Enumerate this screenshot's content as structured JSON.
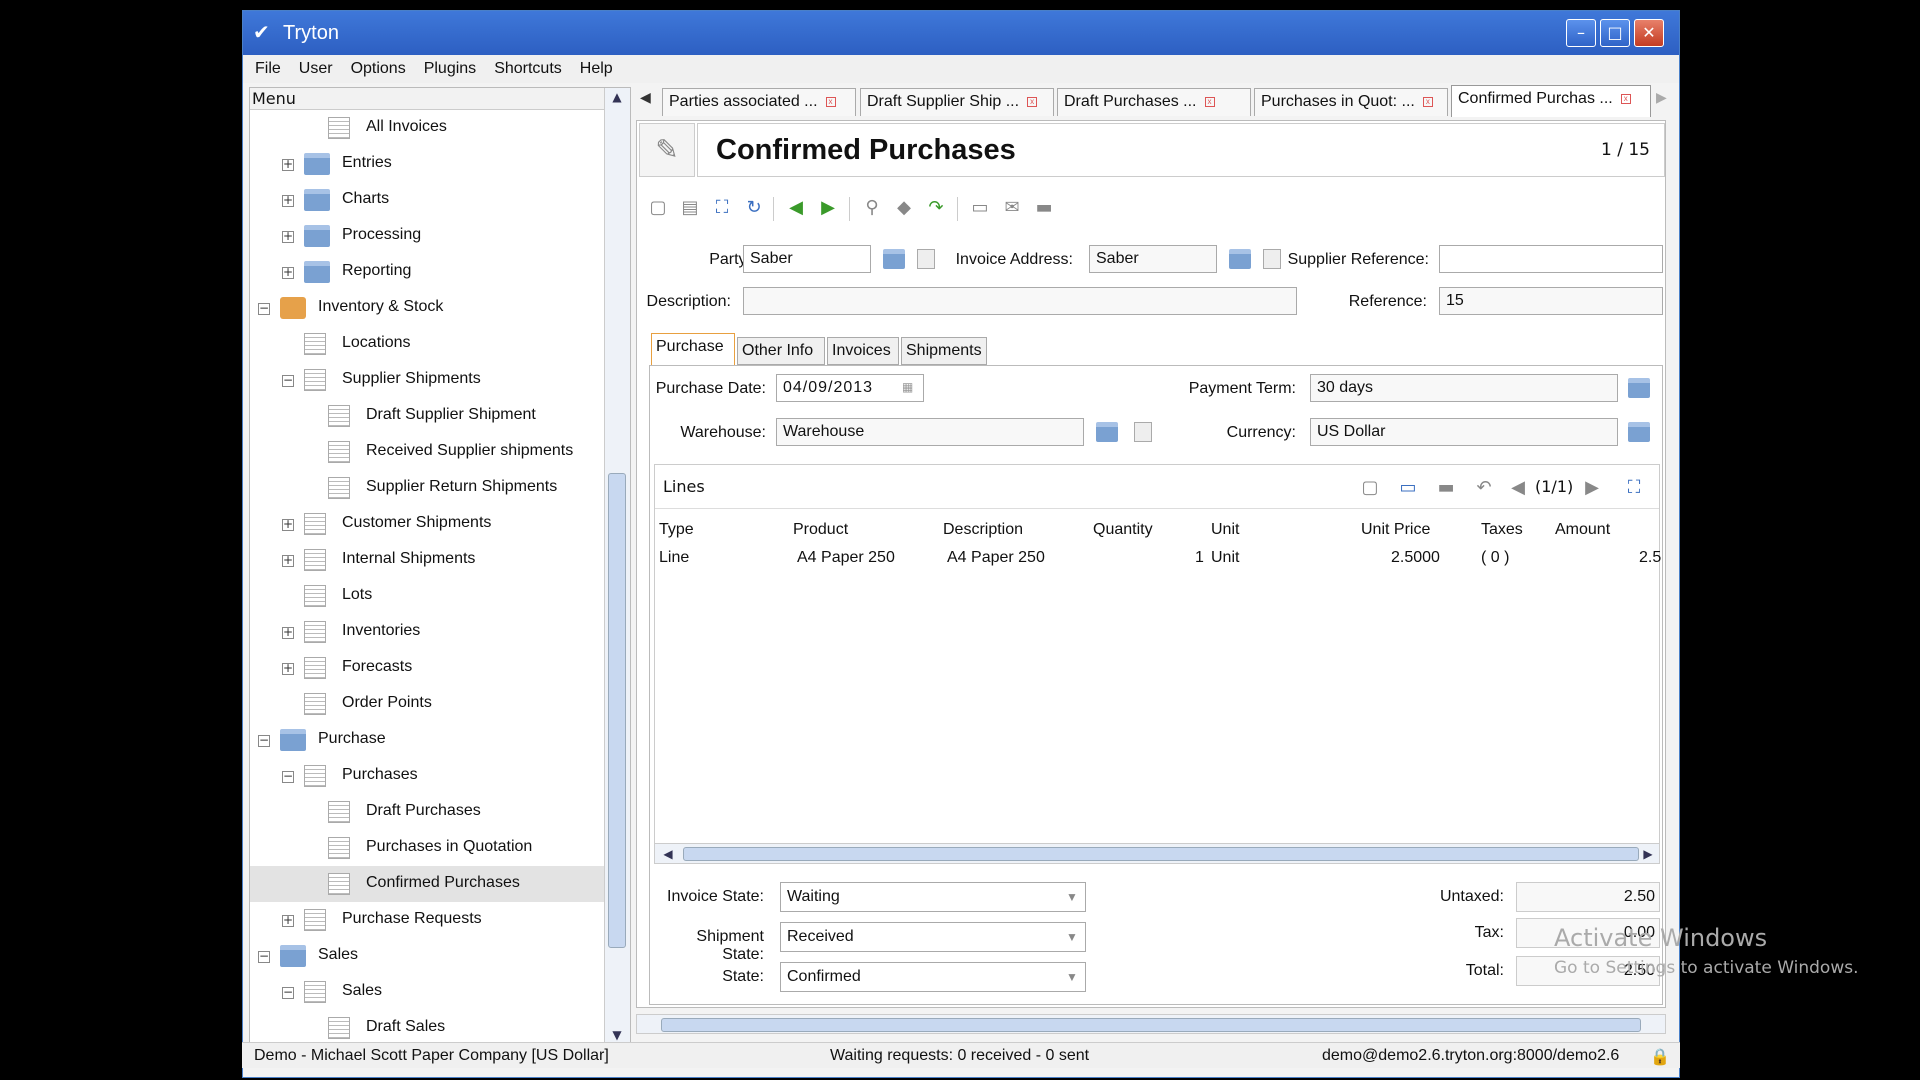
{
  "window": {
    "title": "Tryton"
  },
  "menubar": [
    "File",
    "User",
    "Options",
    "Plugins",
    "Shortcuts",
    "Help"
  ],
  "sidebar": {
    "header": "Menu",
    "items": [
      {
        "label": "All Invoices",
        "level": 2,
        "icon": "doc",
        "toggle": ""
      },
      {
        "label": "Entries",
        "level": 1,
        "icon": "folder",
        "toggle": "+"
      },
      {
        "label": "Charts",
        "level": 1,
        "icon": "folder",
        "toggle": "+"
      },
      {
        "label": "Processing",
        "level": 1,
        "icon": "folder",
        "toggle": "+"
      },
      {
        "label": "Reporting",
        "level": 1,
        "icon": "folder",
        "toggle": "+"
      },
      {
        "label": "Inventory & Stock",
        "level": 0,
        "icon": "inv",
        "toggle": "−"
      },
      {
        "label": "Locations",
        "level": 1,
        "icon": "doc",
        "toggle": ""
      },
      {
        "label": "Supplier Shipments",
        "level": 1,
        "icon": "doc",
        "toggle": "−"
      },
      {
        "label": "Draft Supplier Shipment",
        "level": 2,
        "icon": "doc",
        "toggle": ""
      },
      {
        "label": "Received Supplier shipments",
        "level": 2,
        "icon": "doc",
        "toggle": ""
      },
      {
        "label": "Supplier Return Shipments",
        "level": 2,
        "icon": "doc",
        "toggle": ""
      },
      {
        "label": "Customer Shipments",
        "level": 1,
        "icon": "doc",
        "toggle": "+"
      },
      {
        "label": "Internal Shipments",
        "level": 1,
        "icon": "doc",
        "toggle": "+"
      },
      {
        "label": "Lots",
        "level": 1,
        "icon": "doc",
        "toggle": ""
      },
      {
        "label": "Inventories",
        "level": 1,
        "icon": "doc",
        "toggle": "+"
      },
      {
        "label": "Forecasts",
        "level": 1,
        "icon": "doc",
        "toggle": "+"
      },
      {
        "label": "Order Points",
        "level": 1,
        "icon": "doc",
        "toggle": ""
      },
      {
        "label": "Purchase",
        "level": 0,
        "icon": "folder",
        "toggle": "−"
      },
      {
        "label": "Purchases",
        "level": 1,
        "icon": "doc",
        "toggle": "−"
      },
      {
        "label": "Draft Purchases",
        "level": 2,
        "icon": "doc",
        "toggle": ""
      },
      {
        "label": "Purchases in Quotation",
        "level": 2,
        "icon": "doc",
        "toggle": ""
      },
      {
        "label": "Confirmed Purchases",
        "level": 2,
        "icon": "doc",
        "toggle": "",
        "selected": true
      },
      {
        "label": "Purchase Requests",
        "level": 1,
        "icon": "doc",
        "toggle": "+"
      },
      {
        "label": "Sales",
        "level": 0,
        "icon": "folder",
        "toggle": "−"
      },
      {
        "label": "Sales",
        "level": 1,
        "icon": "doc",
        "toggle": "−"
      },
      {
        "label": "Draft Sales",
        "level": 2,
        "icon": "doc",
        "toggle": ""
      }
    ]
  },
  "tabs": [
    {
      "label": "Parties associated ..."
    },
    {
      "label": "Draft Supplier Ship ..."
    },
    {
      "label": "Draft Purchases     ..."
    },
    {
      "label": "Purchases in Quot: ..."
    },
    {
      "label": "Confirmed Purchas ...",
      "active": true
    }
  ],
  "form": {
    "title": "Confirmed Purchases",
    "counter": "1 / 15",
    "party_label": "Party:",
    "party_value": "Saber",
    "invoice_address_label": "Invoice Address:",
    "invoice_address_value": "Saber",
    "supplier_reference_label": "Supplier Reference:",
    "supplier_reference_value": "",
    "description_label": "Description:",
    "description_value": "",
    "reference_label": "Reference:",
    "reference_value": "15",
    "subtabs": [
      "Purchase",
      "Other Info",
      "Invoices",
      "Shipments"
    ],
    "purchase_date_label": "Purchase Date:",
    "purchase_date_value": "04/09/2013",
    "payment_term_label": "Payment Term:",
    "payment_term_value": "30 days",
    "warehouse_label": "Warehouse:",
    "warehouse_value": "Warehouse",
    "currency_label": "Currency:",
    "currency_value": "US Dollar",
    "lines_label": "Lines",
    "lines_counter": "(1/1)",
    "columns": [
      "Type",
      "Product",
      "Description",
      "Quantity",
      "Unit",
      "Unit Price",
      "Taxes",
      "Amount"
    ],
    "rows": [
      {
        "type": "Line",
        "product": "A4 Paper 250",
        "description": "A4 Paper 250",
        "quantity": "1",
        "unit": "Unit",
        "unit_price": "2.5000",
        "taxes": "( 0 )",
        "amount": "2.5"
      }
    ],
    "invoice_state_label": "Invoice State:",
    "invoice_state_value": "Waiting",
    "shipment_state_label": "Shipment State:",
    "shipment_state_value": "Received",
    "state_label": "State:",
    "state_value": "Confirmed",
    "untaxed_label": "Untaxed:",
    "untaxed_value": "2.50",
    "tax_label": "Tax:",
    "tax_value": "0.00",
    "total_label": "Total:",
    "total_value": "2.50"
  },
  "statusbar": {
    "left": "Demo - Michael Scott Paper Company [US Dollar]",
    "center": "Waiting requests: 0 received - 0 sent",
    "right": "demo@demo2.6.tryton.org:8000/demo2.6"
  },
  "overlay": {
    "activate_title": "Activate Windows",
    "activate_sub": "Go to Settings to activate Windows."
  }
}
